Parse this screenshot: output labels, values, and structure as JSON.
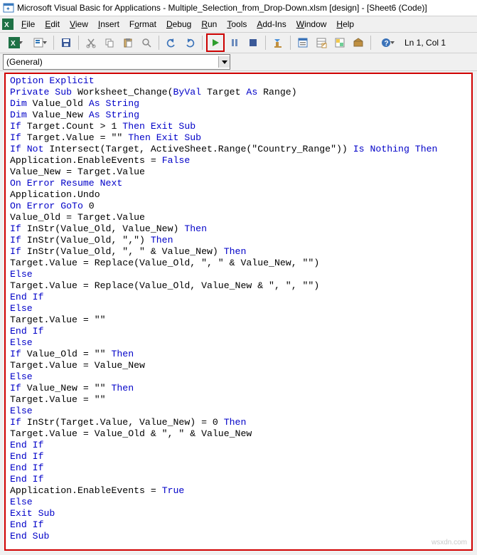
{
  "title": "Microsoft Visual Basic for Applications - Multiple_Selection_from_Drop-Down.xlsm [design] - [Sheet6 (Code)]",
  "menu": {
    "file": "File",
    "edit": "Edit",
    "view": "View",
    "insert": "Insert",
    "format": "Format",
    "debug": "Debug",
    "run": "Run",
    "tools": "Tools",
    "addins": "Add-Ins",
    "window": "Window",
    "help": "Help"
  },
  "toolbar_status": "Ln 1, Col 1",
  "dropdown": {
    "general": "(General)"
  },
  "code_lines": [
    [
      [
        "k",
        "Option Explicit"
      ]
    ],
    [
      [
        "k",
        "Private Sub"
      ],
      [
        "s",
        " Worksheet_Change("
      ],
      [
        "k",
        "ByVal"
      ],
      [
        "s",
        " Target "
      ],
      [
        "k",
        "As"
      ],
      [
        "s",
        " Range)"
      ]
    ],
    [
      [
        "k",
        "Dim"
      ],
      [
        "s",
        " Value_Old "
      ],
      [
        "k",
        "As String"
      ]
    ],
    [
      [
        "k",
        "Dim"
      ],
      [
        "s",
        " Value_New "
      ],
      [
        "k",
        "As String"
      ]
    ],
    [
      [
        "k",
        "If"
      ],
      [
        "s",
        " Target.Count > 1 "
      ],
      [
        "k",
        "Then Exit Sub"
      ]
    ],
    [
      [
        "k",
        "If"
      ],
      [
        "s",
        " Target.Value = \"\" "
      ],
      [
        "k",
        "Then Exit Sub"
      ]
    ],
    [
      [
        "k",
        "If Not"
      ],
      [
        "s",
        " Intersect(Target, ActiveSheet.Range(\"Country_Range\")) "
      ],
      [
        "k",
        "Is Nothing Then"
      ]
    ],
    [
      [
        "s",
        "Application.EnableEvents = "
      ],
      [
        "k",
        "False"
      ]
    ],
    [
      [
        "s",
        "Value_New = Target.Value"
      ]
    ],
    [
      [
        "k",
        "On Error Resume Next"
      ]
    ],
    [
      [
        "s",
        "Application.Undo"
      ]
    ],
    [
      [
        "k",
        "On Error GoTo"
      ],
      [
        "s",
        " 0"
      ]
    ],
    [
      [
        "s",
        "Value_Old = Target.Value"
      ]
    ],
    [
      [
        "k",
        "If"
      ],
      [
        "s",
        " InStr(Value_Old, Value_New) "
      ],
      [
        "k",
        "Then"
      ]
    ],
    [
      [
        "k",
        "If"
      ],
      [
        "s",
        " InStr(Value_Old, \",\") "
      ],
      [
        "k",
        "Then"
      ]
    ],
    [
      [
        "k",
        "If"
      ],
      [
        "s",
        " InStr(Value_Old, \", \" & Value_New) "
      ],
      [
        "k",
        "Then"
      ]
    ],
    [
      [
        "s",
        "Target.Value = Replace(Value_Old, \", \" & Value_New, \"\")"
      ]
    ],
    [
      [
        "k",
        "Else"
      ]
    ],
    [
      [
        "s",
        "Target.Value = Replace(Value_Old, Value_New & \", \", \"\")"
      ]
    ],
    [
      [
        "k",
        "End If"
      ]
    ],
    [
      [
        "k",
        "Else"
      ]
    ],
    [
      [
        "s",
        "Target.Value = \"\""
      ]
    ],
    [
      [
        "k",
        "End If"
      ]
    ],
    [
      [
        "k",
        "Else"
      ]
    ],
    [
      [
        "k",
        "If"
      ],
      [
        "s",
        " Value_Old = \"\" "
      ],
      [
        "k",
        "Then"
      ]
    ],
    [
      [
        "s",
        "Target.Value = Value_New"
      ]
    ],
    [
      [
        "k",
        "Else"
      ]
    ],
    [
      [
        "k",
        "If"
      ],
      [
        "s",
        " Value_New = \"\" "
      ],
      [
        "k",
        "Then"
      ]
    ],
    [
      [
        "s",
        "Target.Value = \"\""
      ]
    ],
    [
      [
        "k",
        "Else"
      ]
    ],
    [
      [
        "k",
        "If"
      ],
      [
        "s",
        " InStr(Target.Value, Value_New) = 0 "
      ],
      [
        "k",
        "Then"
      ]
    ],
    [
      [
        "s",
        "Target.Value = Value_Old & \", \" & Value_New"
      ]
    ],
    [
      [
        "k",
        "End If"
      ]
    ],
    [
      [
        "k",
        "End If"
      ]
    ],
    [
      [
        "k",
        "End If"
      ]
    ],
    [
      [
        "k",
        "End If"
      ]
    ],
    [
      [
        "s",
        "Application.EnableEvents = "
      ],
      [
        "k",
        "True"
      ]
    ],
    [
      [
        "k",
        "Else"
      ]
    ],
    [
      [
        "k",
        "Exit Sub"
      ]
    ],
    [
      [
        "k",
        "End If"
      ]
    ],
    [
      [
        "k",
        "End Sub"
      ]
    ]
  ],
  "watermark": "wsxdn.com"
}
